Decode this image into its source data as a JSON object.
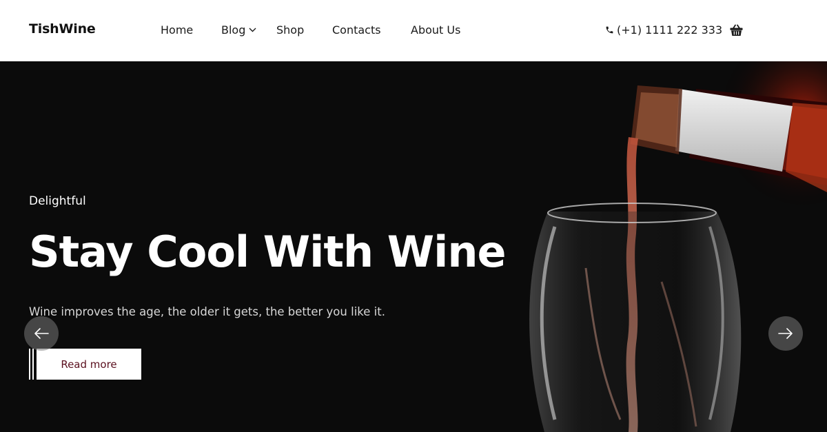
{
  "header": {
    "logo": "TishWine",
    "nav": [
      {
        "label": "Home"
      },
      {
        "label": "Blog",
        "has_dropdown": true
      },
      {
        "label": "Shop"
      },
      {
        "label": "Contacts"
      },
      {
        "label": "About Us"
      }
    ],
    "phone": "(+1) 1111 222 333",
    "phone_icon": "phone-icon",
    "cart_icon": "basket-icon"
  },
  "hero": {
    "eyebrow": "Delightful",
    "headline": "Stay Cool With Wine",
    "subtext": "Wine improves the age, the older it gets, the better you like it.",
    "cta_label": "Read more",
    "prev_icon": "arrow-left-icon",
    "next_icon": "arrow-right-icon"
  },
  "colors": {
    "hero_background": "#0b0b0b",
    "cta_text": "#5a0f1e",
    "wine": "#8c2a22"
  }
}
